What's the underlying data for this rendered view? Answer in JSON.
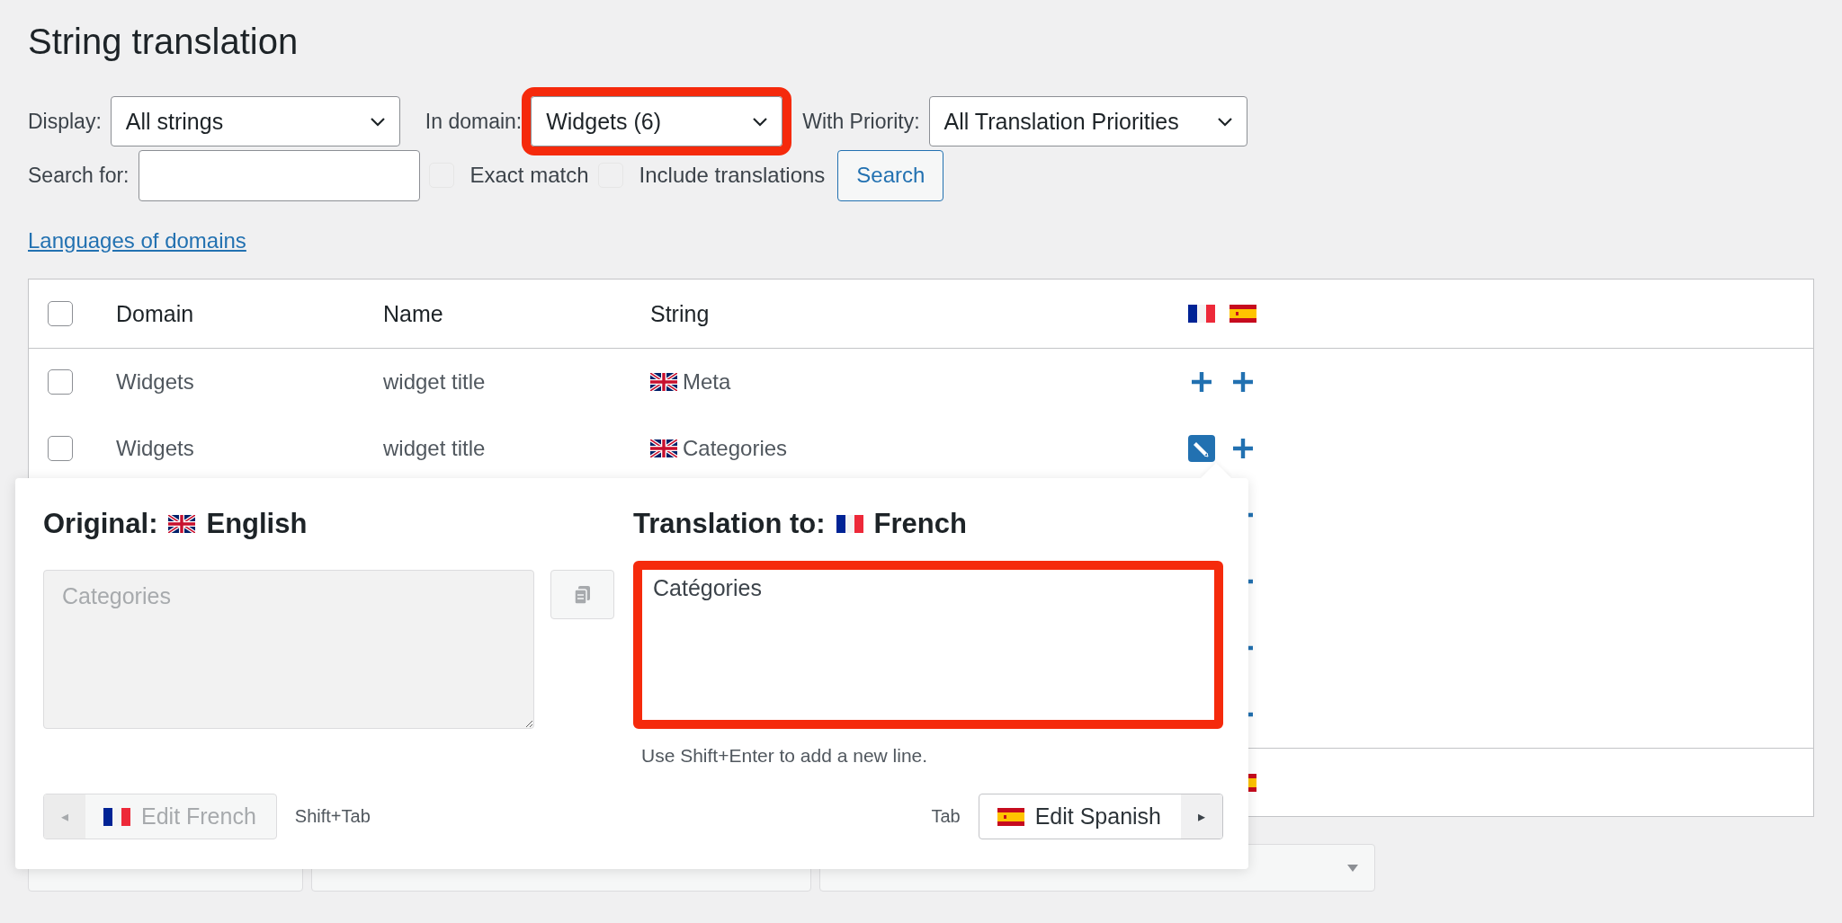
{
  "title": "String translation",
  "filters": {
    "display": {
      "label": "Display:",
      "value": "All strings"
    },
    "domain": {
      "label": "In domain:",
      "value": "Widgets (6)",
      "highlighted": true
    },
    "priority": {
      "label": "With Priority:",
      "value": "All Translation Priorities"
    },
    "search": {
      "label": "Search for:"
    },
    "options": [
      {
        "label": "Exact match",
        "checked": false
      },
      {
        "label": "Include translations",
        "checked": false
      }
    ],
    "search_button": "Search"
  },
  "languages_link": "Languages of domains",
  "table": {
    "select_all": false,
    "columns": [
      "Domain",
      "Name",
      "String"
    ],
    "rows": [
      {
        "selected": false,
        "domain": "Widgets",
        "name": "widget title",
        "string": "Meta",
        "translations": [
          {
            "translated": false
          },
          {
            "translated": false
          }
        ]
      },
      {
        "selected": false,
        "domain": "Widgets",
        "name": "widget title",
        "string": "Categories",
        "translations": [
          {
            "translated": true
          },
          {
            "translated": false
          }
        ]
      },
      {
        "translations": [
          {
            "translated": false
          }
        ]
      },
      {
        "translations": [
          {
            "translated": false
          }
        ]
      },
      {
        "translations": [
          {
            "translated": false
          }
        ]
      },
      {
        "translations": [
          {
            "translated": false
          }
        ]
      }
    ]
  },
  "bulk_actions": [
    {
      "kind": "button"
    },
    {
      "kind": "button"
    },
    {
      "kind": "select"
    }
  ],
  "popup": {
    "original_heading": "Original:",
    "original_language": "English",
    "translation_heading": "Translation to:",
    "translation_language": "French",
    "original_text": "Categories",
    "translation_text": "Catégories",
    "translation_highlighted": true,
    "hint": "Use Shift+Enter to add a new line.",
    "prev": {
      "arrow": "◂",
      "label": "Edit French",
      "shortcut": "Shift+Tab",
      "disabled": true
    },
    "next": {
      "arrow": "▸",
      "label": "Edit Spanish",
      "shortcut": "Tab",
      "disabled": false
    }
  }
}
